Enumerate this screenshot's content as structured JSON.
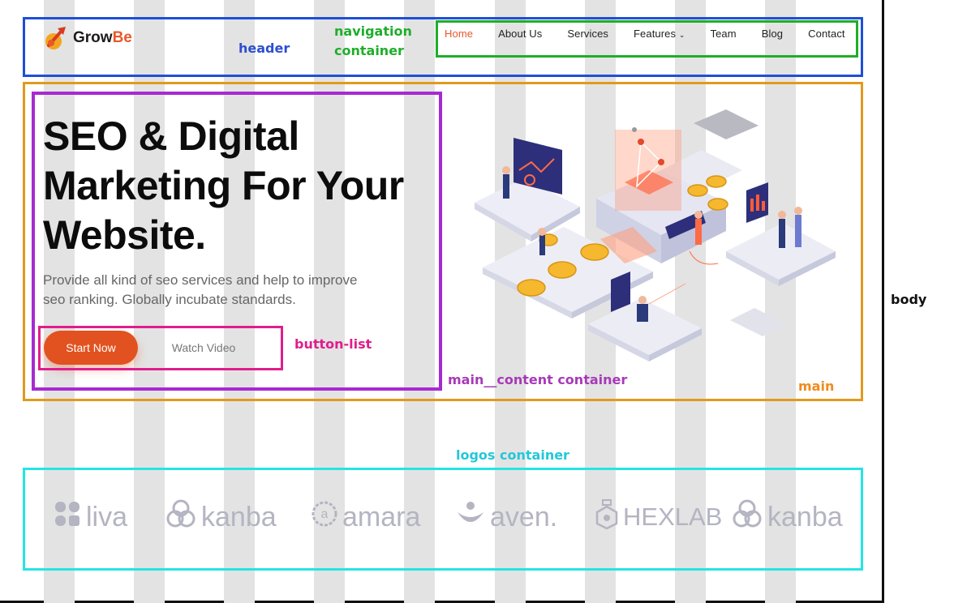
{
  "header": {
    "brand": {
      "grow": "Grow",
      "be": "Be"
    },
    "nav": [
      {
        "label": "Home",
        "active": true
      },
      {
        "label": "About Us"
      },
      {
        "label": "Services"
      },
      {
        "label": "Features"
      },
      {
        "label": "Team"
      },
      {
        "label": "Blog"
      },
      {
        "label": "Contact"
      }
    ]
  },
  "hero": {
    "title_lines": [
      "SEO & Digital",
      "Marketing For Your",
      "Website."
    ],
    "subtitle_lines": [
      "Provide all kind of seo services and help to improve",
      "seo ranking. Globally incubate standards."
    ],
    "start_button": "Start Now",
    "watch_button": "Watch Video"
  },
  "logos": [
    "liva",
    "kanba",
    "amara",
    "aven.",
    "HEXLAB",
    "kanba"
  ],
  "annotations": {
    "header": "header",
    "navigation": "navigation container",
    "main": "main",
    "main_content": "main__content container",
    "button_list": "button-list",
    "logos": "logos container",
    "body": "body"
  },
  "colors": {
    "accent": "#e8582a",
    "header_box": "#1f4fd6",
    "nav_box": "#1fae2a",
    "main_box": "#e19a1e",
    "content_box": "#a72ad1",
    "button_box": "#e01d8c",
    "logos_box": "#25e4e4"
  },
  "icons": [
    "rocket-logo-icon",
    "chevron-down-icon",
    "liva-logo-icon",
    "kanba-logo-icon",
    "amara-logo-icon",
    "aven-logo-icon",
    "hexlab-logo-icon"
  ]
}
